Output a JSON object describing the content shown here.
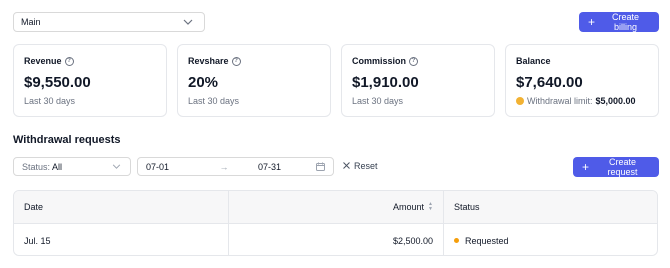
{
  "account_select": {
    "value": "Main"
  },
  "create_billing": {
    "label": "Create billing"
  },
  "cards": [
    {
      "title": "Revenue",
      "value": "$9,550.00",
      "sub": "Last 30 days"
    },
    {
      "title": "Revshare",
      "value": "20%",
      "sub": "Last 30 days"
    },
    {
      "title": "Commission",
      "value": "$1,910.00",
      "sub": "Last 30 days"
    },
    {
      "title": "Balance",
      "value": "$7,640.00",
      "sub_label": "Withdrawal limit:",
      "sub_value": "$5,000.00"
    }
  ],
  "withdrawals": {
    "title": "Withdrawal requests",
    "filters": {
      "status_label": "Status:",
      "status_value": "All",
      "date_from": "07-01",
      "date_to": "07-31",
      "reset_label": "Reset"
    },
    "create_label": "Create request",
    "table": {
      "headers": [
        "Date",
        "Amount",
        "Status"
      ],
      "rows": [
        {
          "date": "Jul. 15",
          "amount": "$2,500.00",
          "status": "Requested"
        }
      ]
    }
  },
  "colors": {
    "accent": "#4f5be8",
    "warning": "#f2b233",
    "status_requested": "#f59e0b"
  }
}
